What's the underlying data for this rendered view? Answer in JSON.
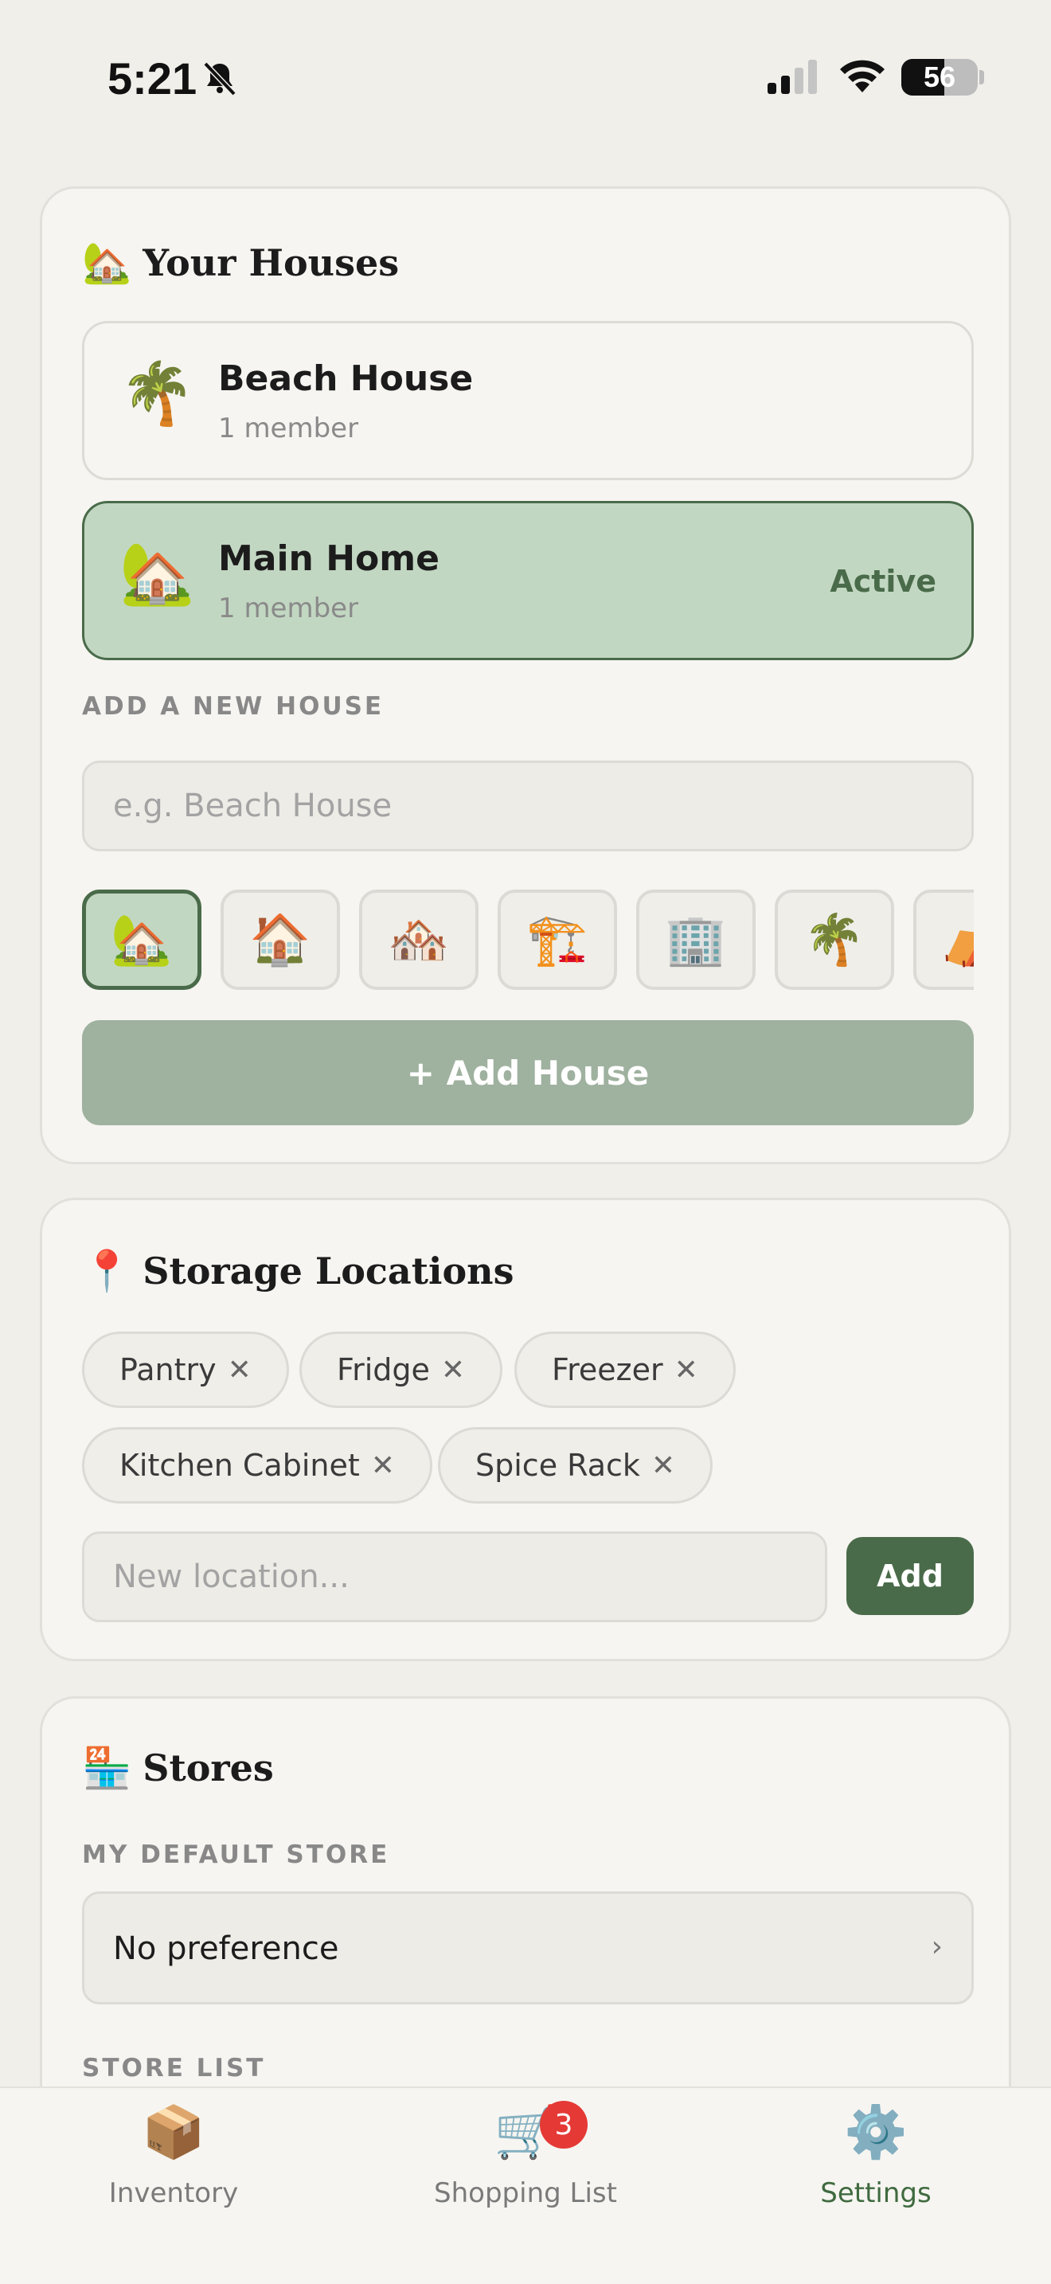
{
  "status_bar": {
    "time": "5:21",
    "battery": "56",
    "battery_level_percent": 56
  },
  "houses_card": {
    "title_emoji": "🏡",
    "title": "Your Houses",
    "houses": [
      {
        "emoji": "🌴",
        "name": "Beach House",
        "members": "1 member",
        "active": false
      },
      {
        "emoji": "🏡",
        "name": "Main Home",
        "members": "1 member",
        "active": true,
        "active_label": "Active"
      }
    ],
    "add_label": "ADD A NEW HOUSE",
    "name_placeholder": "e.g. Beach House",
    "icon_options": [
      "🏡",
      "🏠",
      "🏘️",
      "🏗️",
      "🏢",
      "🌴",
      "⛺"
    ],
    "selected_icon_index": 0,
    "add_button": "+ Add House"
  },
  "storage_card": {
    "title_emoji": "📍",
    "title": "Storage Locations",
    "locations": [
      "Pantry",
      "Fridge",
      "Freezer",
      "Kitchen Cabinet",
      "Spice Rack"
    ],
    "remove_glyph": "✕",
    "input_placeholder": "New location...",
    "add_button": "Add"
  },
  "stores_card": {
    "title_emoji": "🏪",
    "title": "Stores",
    "default_label": "MY DEFAULT STORE",
    "default_value": "No preference",
    "chevron": "›",
    "list_label": "STORE LIST"
  },
  "tab_bar": {
    "tabs": [
      {
        "icon": "📦",
        "label": "Inventory",
        "active": false
      },
      {
        "icon": "🛒",
        "label": "Shopping List",
        "active": false,
        "badge": "3"
      },
      {
        "icon": "⚙️",
        "label": "Settings",
        "active": true
      }
    ]
  },
  "colors": {
    "accent": "#4a6b4a",
    "active_bg": "#c2d7c2",
    "disabled_button": "#9fb19f",
    "badge": "#e53935",
    "background": "#f0efea"
  }
}
